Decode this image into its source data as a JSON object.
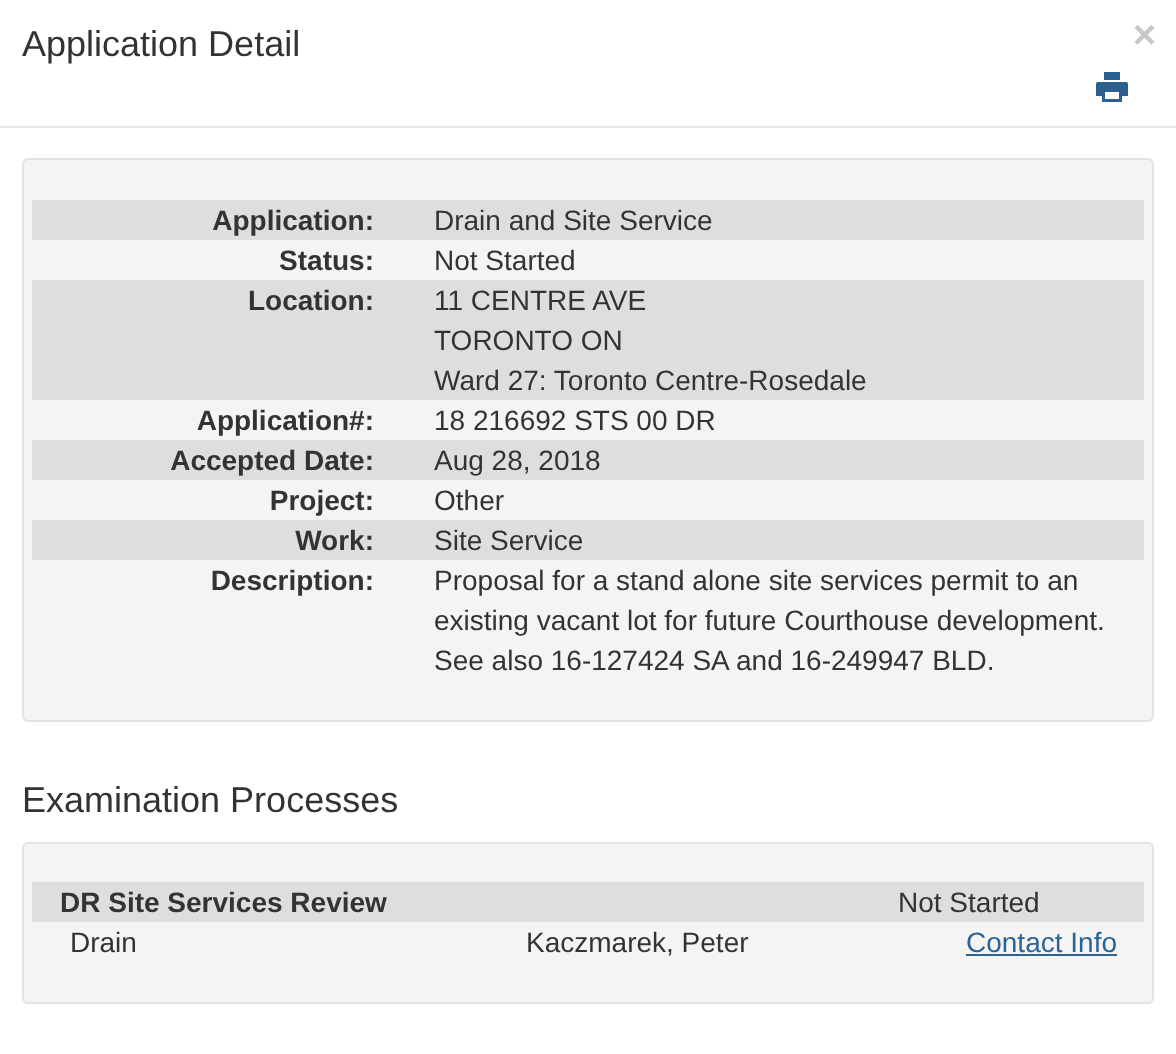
{
  "dialog": {
    "title": "Application Detail",
    "close": "×"
  },
  "details": [
    {
      "label": "Application:",
      "lines": [
        "Drain and Site Service"
      ]
    },
    {
      "label": "Status:",
      "lines": [
        "Not Started"
      ]
    },
    {
      "label": "Location:",
      "lines": [
        "11 CENTRE AVE",
        "TORONTO ON",
        "Ward 27: Toronto Centre-Rosedale"
      ]
    },
    {
      "label": "Application#:",
      "lines": [
        "18 216692 STS 00 DR"
      ]
    },
    {
      "label": "Accepted Date:",
      "lines": [
        "Aug 28, 2018"
      ]
    },
    {
      "label": "Project:",
      "lines": [
        "Other"
      ]
    },
    {
      "label": "Work:",
      "lines": [
        "Site Service"
      ]
    },
    {
      "label": "Description:",
      "lines": [
        "Proposal for a stand alone site services permit to an",
        "existing vacant lot for future Courthouse development.",
        "See also 16-127424 SA and 16-249947 BLD."
      ]
    }
  ],
  "examination": {
    "heading": "Examination Processes",
    "processes": [
      {
        "name": "DR Site Services Review",
        "status": "Not Started",
        "tasks": [
          {
            "name": "Drain",
            "examiner": "Kaczmarek, Peter",
            "link": "Contact Info"
          }
        ]
      }
    ]
  }
}
